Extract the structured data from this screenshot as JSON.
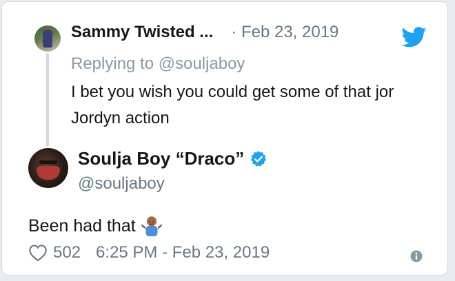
{
  "reply": {
    "author_name": "Sammy Twisted ...",
    "date": "· Feb 23, 2019",
    "replying_to": "Replying to @souljaboy",
    "text": "I bet you wish you could get some of that jor Jordyn action"
  },
  "tweet": {
    "author_name": "Soulja Boy “Draco”",
    "handle": "@souljaboy",
    "text": "Been had that",
    "likes": "502",
    "timestamp": "6:25 PM - Feb 23, 2019"
  },
  "icons": {
    "brand": "twitter-bird-icon",
    "verified": "verified-badge-icon",
    "emoji": "person-shrugging-emoji",
    "like": "heart-icon",
    "info": "info-icon"
  },
  "colors": {
    "twitter_blue": "#1da1f2",
    "secondary_text": "#657786",
    "thread_line": "#cfd9de"
  }
}
